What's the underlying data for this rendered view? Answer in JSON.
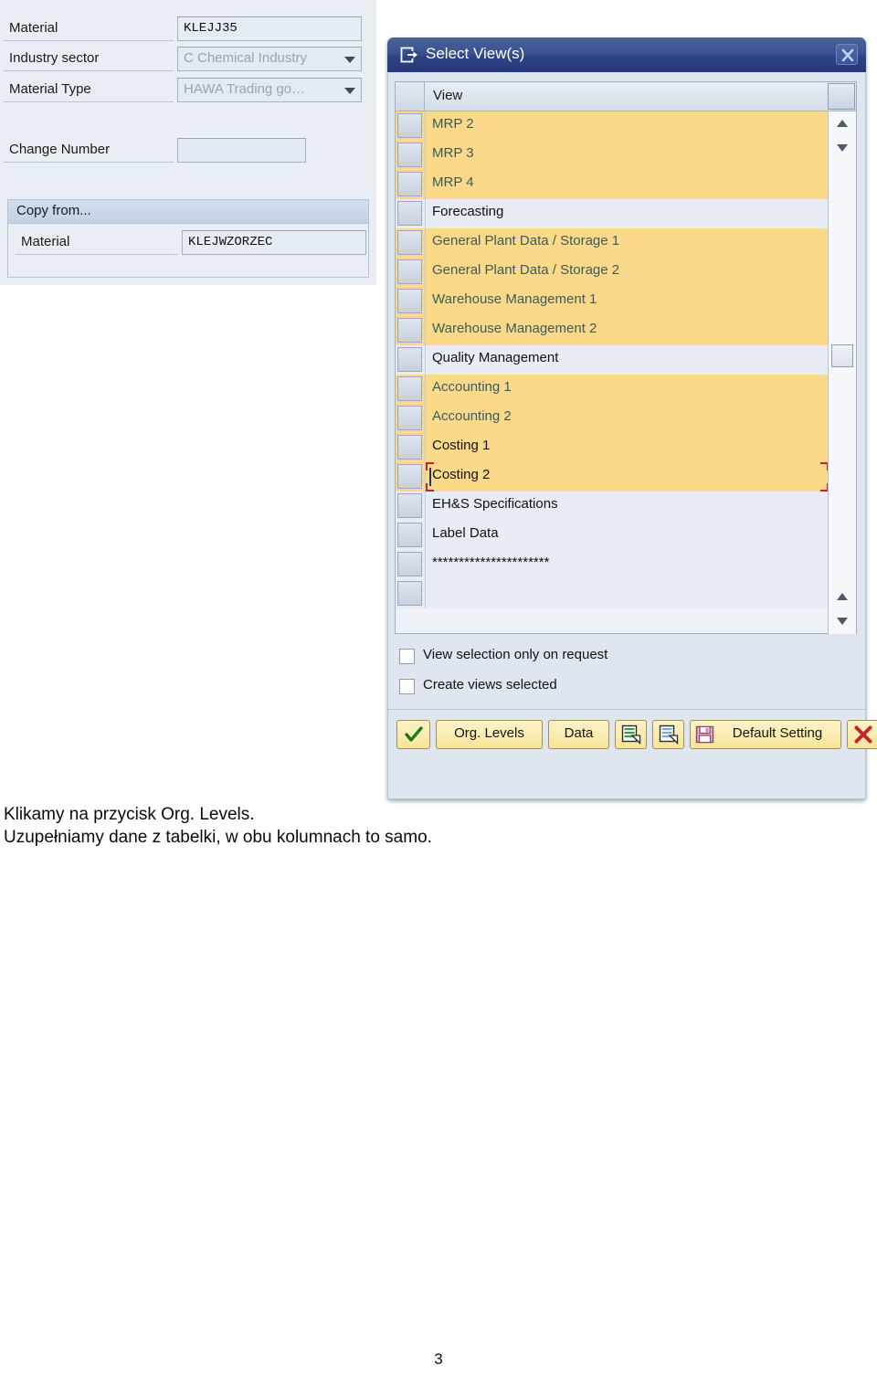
{
  "form": {
    "rows": [
      {
        "label": "Material",
        "value": "KLEJJ35",
        "type": "text",
        "disabled": false
      },
      {
        "label": "Industry sector",
        "value": "C Chemical Industry",
        "type": "dropdown",
        "disabled": true
      },
      {
        "label": "Material Type",
        "value": "HAWA Trading go…",
        "type": "dropdown",
        "disabled": true
      }
    ],
    "change_number": {
      "label": "Change Number",
      "value": ""
    },
    "copy_from": {
      "title": "Copy from...",
      "material_label": "Material",
      "material_value": "KLEJWZORZEC"
    }
  },
  "dialog": {
    "title": "Select View(s)",
    "title_icon": "export-view-icon",
    "close_icon": "close-icon",
    "table": {
      "column_header": "View",
      "rows": [
        {
          "label": "MRP 2",
          "selected": true,
          "dark_text": false,
          "focused": false
        },
        {
          "label": "MRP 3",
          "selected": true,
          "dark_text": false,
          "focused": false
        },
        {
          "label": "MRP 4",
          "selected": true,
          "dark_text": false,
          "focused": false
        },
        {
          "label": "Forecasting",
          "selected": false,
          "dark_text": true,
          "focused": false
        },
        {
          "label": "General Plant Data / Storage 1",
          "selected": true,
          "dark_text": false,
          "focused": false
        },
        {
          "label": "General Plant Data / Storage 2",
          "selected": true,
          "dark_text": false,
          "focused": false
        },
        {
          "label": "Warehouse Management 1",
          "selected": true,
          "dark_text": false,
          "focused": false
        },
        {
          "label": "Warehouse Management 2",
          "selected": true,
          "dark_text": false,
          "focused": false
        },
        {
          "label": "Quality Management",
          "selected": false,
          "dark_text": true,
          "focused": false
        },
        {
          "label": "Accounting 1",
          "selected": true,
          "dark_text": false,
          "focused": false
        },
        {
          "label": "Accounting 2",
          "selected": true,
          "dark_text": false,
          "focused": false
        },
        {
          "label": "Costing 1",
          "selected": true,
          "dark_text": true,
          "focused": false
        },
        {
          "label": "Costing 2",
          "selected": true,
          "dark_text": true,
          "focused": true
        },
        {
          "label": "EH&S Specifications",
          "selected": false,
          "dark_text": true,
          "focused": false
        },
        {
          "label": "Label Data",
          "selected": false,
          "dark_text": true,
          "focused": false
        },
        {
          "label": "**********************",
          "selected": false,
          "dark_text": true,
          "focused": false
        },
        {
          "label": "",
          "selected": false,
          "dark_text": true,
          "focused": false
        }
      ]
    },
    "checkboxes": [
      {
        "label": "View selection only on request",
        "checked": false
      },
      {
        "label": "Create views selected",
        "checked": false
      }
    ],
    "toolbar": [
      {
        "name": "continue-button",
        "label": "",
        "icon": "green-check-icon"
      },
      {
        "name": "org-levels-button",
        "label": "Org. Levels",
        "icon": ""
      },
      {
        "name": "data-button",
        "label": "Data",
        "icon": ""
      },
      {
        "name": "copy-green-list-button",
        "label": "",
        "icon": "green-list-arrow-icon"
      },
      {
        "name": "copy-blue-list-button",
        "label": "",
        "icon": "blue-list-arrow-icon"
      },
      {
        "name": "default-setting-button",
        "label": "Default Setting",
        "icon": "save-disk-icon"
      },
      {
        "name": "cancel-button",
        "label": "",
        "icon": "red-x-icon"
      }
    ]
  },
  "caption": {
    "line1": "Klikamy na przycisk Org. Levels.",
    "line2": "Uzupełniamy dane z tabelki, w obu kolumnach to samo."
  },
  "page_number": "3",
  "colors": {
    "selected_row": "#fbd98a",
    "row": "#e8edf5",
    "titlebar": "#33498a",
    "focus_frame": "#c1262a",
    "toolbar_button": "#f7e49a"
  }
}
